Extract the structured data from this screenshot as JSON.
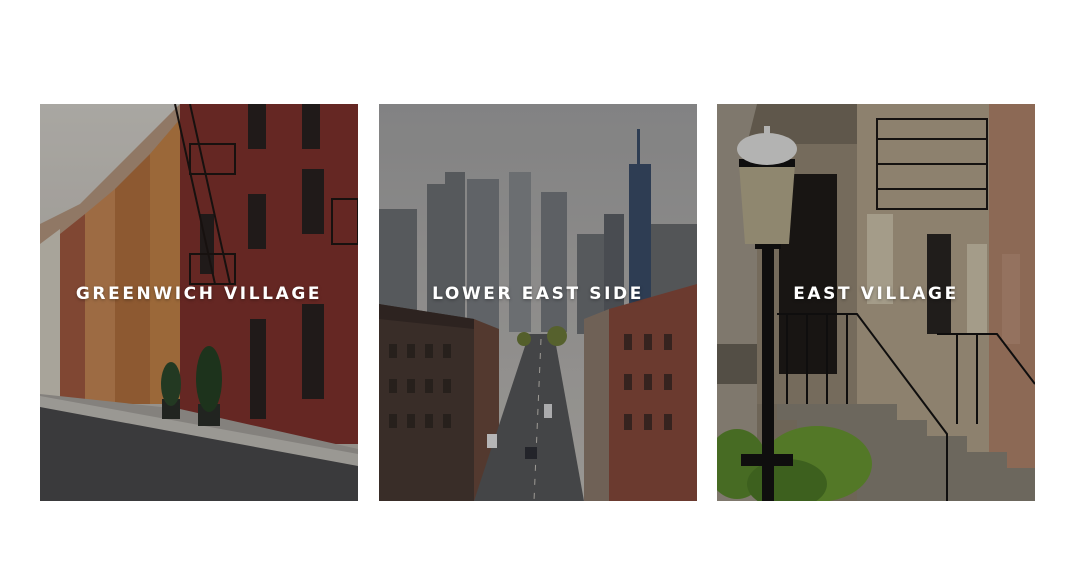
{
  "neighborhoods": [
    {
      "title": "GREENWICH VILLAGE",
      "image": "brownstone-street-photo"
    },
    {
      "title": "LOWER EAST SIDE",
      "image": "skyline-avenue-photo"
    },
    {
      "title": "EAST VILLAGE",
      "image": "stoop-lamppost-photo"
    }
  ],
  "colors": {
    "background": "#ffffff",
    "title_text": "#ffffff",
    "overlay": "rgba(0,0,0,0.22)"
  }
}
